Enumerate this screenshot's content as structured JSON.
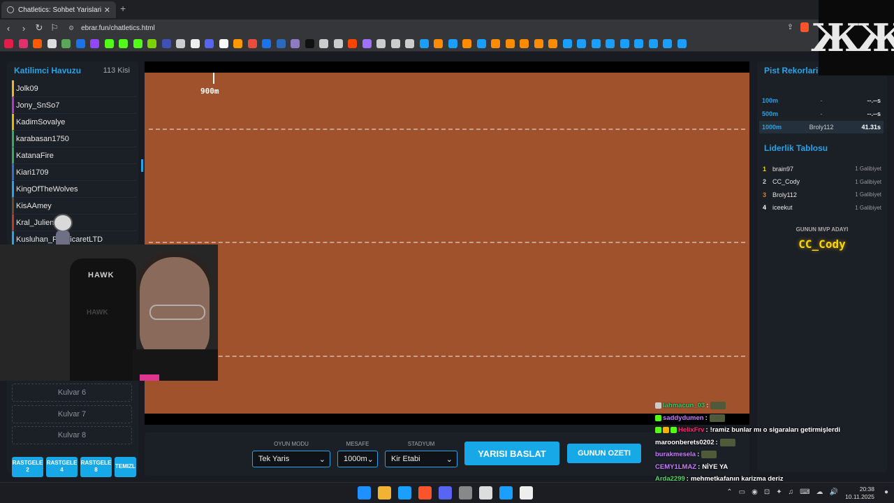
{
  "browser": {
    "tab_title": "Chatletics: Sohbet Yarislari",
    "tab_close": "✕",
    "new_tab": "+",
    "url": "ebrar.fun/chatletics.html",
    "nav": {
      "back": "‹",
      "forward": "›",
      "reload": "↻",
      "bookmark": "⚐"
    },
    "bookmark_colors": [
      "#e11d48",
      "#e1306c",
      "#ff5a00",
      "#dddddd",
      "#5aa65a",
      "#1a73e8",
      "#9146ff",
      "#53fc18",
      "#53fc18",
      "#53fc18",
      "#7bd400",
      "#3f51b5",
      "#cccccc",
      "#eeeeee",
      "#5865f2",
      "#ffffff",
      "#ff9900",
      "#e74c3c",
      "#1a73e8",
      "#2a6ab8",
      "#8e7cc3",
      "#111111",
      "#cccccc",
      "#cccccc",
      "#ff4500",
      "#a070ff",
      "#cccccc",
      "#cccccc",
      "#cccccc",
      "#1a9fff",
      "#ff8c00",
      "#1a9fff",
      "#ff8c00",
      "#1a9fff",
      "#ff8c00",
      "#ff8c00",
      "#ff8c00",
      "#ff8c00",
      "#ff8c00",
      "#1a9fff",
      "#1a9fff",
      "#1a9fff",
      "#1a9fff",
      "#1a9fff",
      "#1a9fff",
      "#1a9fff",
      "#1a9fff",
      "#1a9fff"
    ]
  },
  "left": {
    "title": "Katilimci Havuzu",
    "count": "113 Kisi",
    "players": [
      {
        "name": "Jolk09",
        "color": "#f0b429"
      },
      {
        "name": "Jony_SnSo7",
        "color": "#b23ac7"
      },
      {
        "name": "KadimSovalye",
        "color": "#e6b800"
      },
      {
        "name": "karabasan1750",
        "color": "#3aa76d"
      },
      {
        "name": "KatanaFire",
        "color": "#3aa76d"
      },
      {
        "name": "Kiari1709",
        "color": "#2f6fd6"
      },
      {
        "name": "KingOfTheWolves",
        "color": "#2aa3e6"
      },
      {
        "name": "KisAAmey",
        "color": "#6c4a2a"
      },
      {
        "name": "Kral_Julien",
        "color": "#c0392b"
      },
      {
        "name": "Kusluhan_PazTicaretLTD",
        "color": "#2aa3e6"
      }
    ],
    "lanes": [
      "Kulvar 6",
      "Kulvar 7",
      "Kulvar 8"
    ],
    "random_buttons": [
      {
        "l1": "RASTGELE",
        "l2": "2"
      },
      {
        "l1": "RASTGELE",
        "l2": "4"
      },
      {
        "l1": "RASTGELE",
        "l2": "8"
      }
    ],
    "clear_button": "TEMIZL"
  },
  "track": {
    "marker_label": "900m",
    "color": "#a0522d"
  },
  "controls": {
    "mode_caption": "OYUN MODU",
    "mode_value": "Tek Yaris",
    "distance_caption": "MESAFE",
    "distance_value": "1000m",
    "stadium_caption": "STADYUM",
    "stadium_value": "Kir Etabi",
    "start_button": "YARISI BASLAT",
    "summary_button": "GUNUN OZETI",
    "dropdown_arrow": "⌄"
  },
  "right": {
    "records_title": "Pist Rekorlari",
    "records": [
      {
        "distance": "100m",
        "holder": "-",
        "time": "--.--s"
      },
      {
        "distance": "500m",
        "holder": "-",
        "time": "--.--s"
      },
      {
        "distance": "1000m",
        "holder": "Broly112",
        "time": "41.31s"
      }
    ],
    "leaderboard_title": "Liderlik Tablosu",
    "leaderboard": [
      {
        "rank": "1",
        "name": "brain97",
        "wins": "1 Galibiyet",
        "color": "#ffd400"
      },
      {
        "rank": "2",
        "name": "CC_Cody",
        "wins": "1 Galibiyet",
        "color": "#cccccc"
      },
      {
        "rank": "3",
        "name": "Broly112",
        "wins": "1 Galibiyet",
        "color": "#e07b2a"
      },
      {
        "rank": "4",
        "name": "iceekut",
        "wins": "1 Galibiyet",
        "color": "#ffffff"
      }
    ],
    "mvp_caption": "GUNUN MVP ADAYI",
    "mvp_name": "CC_Cody"
  },
  "overlay": {
    "webcam_logo": "HAWK",
    "webcam_logo2": "HAWK",
    "channel_mark": "ЖЖ"
  },
  "chat": [
    {
      "user": "lahmacun_03",
      "color": "#2ecc71",
      "message": "",
      "emote": true,
      "badges": [
        "#cccccc"
      ]
    },
    {
      "user": "saddydumen",
      "color": "#c77dff",
      "message": "",
      "emote": true,
      "badges": [
        "#53fc18"
      ]
    },
    {
      "user": "HelixFrv",
      "color": "#ff2a6d",
      "message": "!ramiz bunlar mı o sigaraları getirmişlerdi",
      "emote": false,
      "badges": [
        "#53fc18",
        "#ffb000",
        "#53fc18"
      ]
    },
    {
      "user": "maroonberets0202",
      "color": "#ffffff",
      "message": "",
      "emote": true,
      "badges": []
    },
    {
      "user": "burakmesela",
      "color": "#c77dff",
      "message": "",
      "emote": true,
      "badges": []
    },
    {
      "user": "CEMY1LMAZ",
      "color": "#c77dff",
      "message": "NİYE YA",
      "emote": false,
      "badges": []
    },
    {
      "user": "Arda2299",
      "color": "#5ad06f",
      "message": "mehmetkafanın karizma deriz",
      "emote": false,
      "badges": []
    }
  ],
  "taskbar": {
    "icon_colors": [
      "#1e90ff",
      "#f2b233",
      "#1a9fff",
      "#fb542b",
      "#5865f2",
      "#888888",
      "#dddddd",
      "#1a9fff",
      "#eeeeee"
    ],
    "tray": [
      "⌃",
      "▭",
      "◉",
      "⊡",
      "✦",
      "♫",
      "⌨",
      "☁",
      "🔊"
    ],
    "time": "20:38",
    "date": "10.11.2025",
    "bell": "●"
  }
}
